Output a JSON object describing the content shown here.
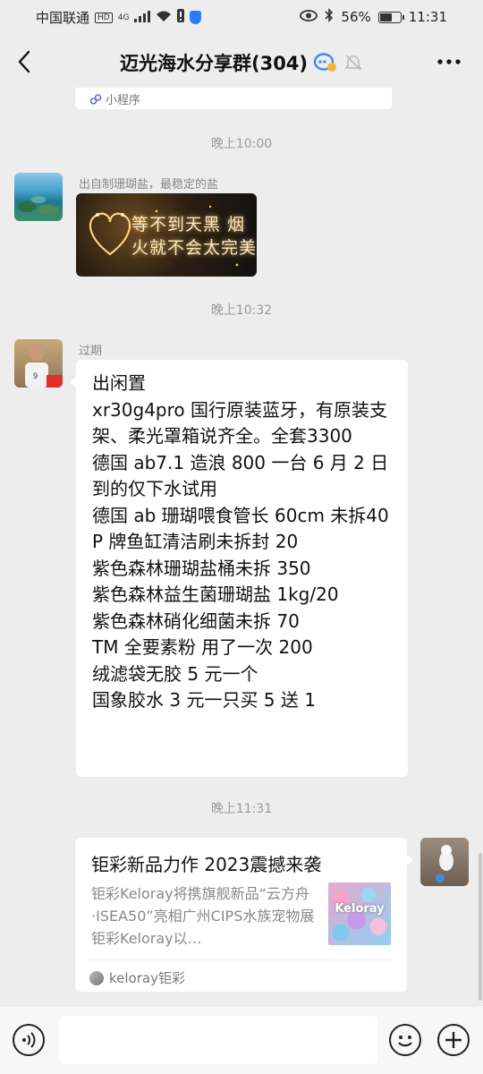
{
  "status_bar": {
    "carrier": "中国联通",
    "network_badge": "HD",
    "network_type": "4G",
    "battery_percent": "56%",
    "battery_level": 0.56,
    "time": "11:31",
    "icons": [
      "hd-icon",
      "signal-icon",
      "wifi-icon",
      "alert-icon",
      "shield-icon",
      "eye-icon",
      "bluetooth-icon",
      "battery-icon"
    ]
  },
  "header": {
    "title": "迈光海水分享群(304)",
    "icons": [
      "back-icon",
      "group-chat-icon",
      "mute-bell-icon",
      "more-icon"
    ]
  },
  "chat": {
    "prev_card": {
      "source_label": "小程序"
    },
    "time_1": "晚上10:00",
    "msg_image": {
      "sender": "出自制珊瑚盐，最稳定的盐",
      "image_text": "等不到天黑 烟火就不会太完美"
    },
    "time_2": "晚上10:32",
    "msg_text": {
      "sender": "过期",
      "body": "出闲置\nxr30g4pro 国行原装蓝牙，有原装支架、柔光罩箱说齐全。全套3300\n德国 ab7.1 造浪 800 一台 6 月 2 日到的仅下水试用\n德国 ab 珊瑚喂食管长 60cm 未拆40\nP 牌鱼缸清洁刷未拆封 20\n紫色森林珊瑚盐桶未拆 350\n紫色森林益生菌珊瑚盐 1kg/20\n紫色森林硝化细菌未拆 70\nTM 全要素粉 用了一次 200\n绒滤袋无胶 5 元一个\n国象胶水 3 元一只买 5 送 1"
    },
    "time_3": "晚上11:31",
    "msg_card": {
      "title": "钜彩新品力作 2023震撼来袭",
      "description": "钜彩Keloray将携旗舰新品“云方舟·ISEA50”亮相广州CIPS水族宠物展钜彩Keloray以…",
      "thumb_text": "Keloray",
      "source": "keloray钜彩"
    }
  },
  "input_bar": {
    "placeholder": "",
    "icons": [
      "voice-icon",
      "emoji-icon",
      "plus-icon"
    ]
  },
  "colors": {
    "background": "#ededed",
    "bubble": "#ffffff",
    "time_label": "#9a9a9a",
    "accent_blue": "#2a7cf6"
  }
}
